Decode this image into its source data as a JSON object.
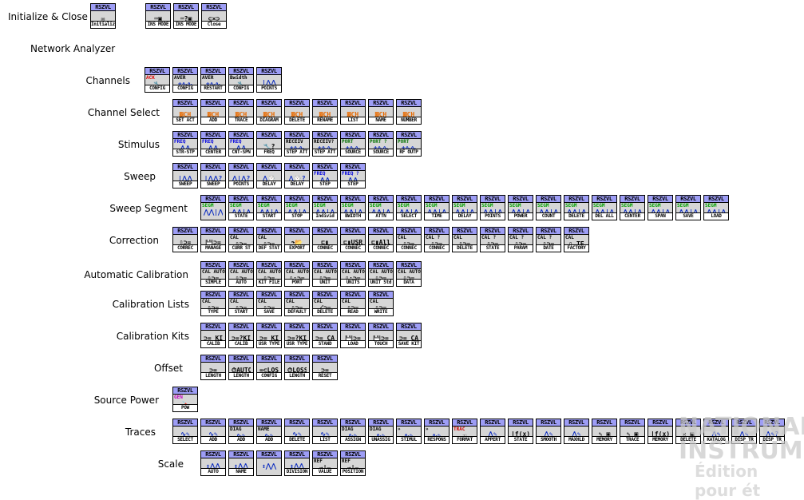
{
  "watermark": {
    "line1": "NATIONAL",
    "line2": "INSTRUMENTS",
    "line3": "Édition pour ét"
  },
  "header_text": "RSZVL",
  "sections": [
    {
      "label": "Initialize & Close",
      "icons": [
        {
          "tag": "",
          "glyph": "✉",
          "tagc": "#c00",
          "foot": "Initialize"
        },
        {
          "gap": true
        },
        {
          "tag": "",
          "glyph": "⌨▣",
          "tagc": "#000",
          "foot": "INS MODE"
        },
        {
          "tag": "",
          "glyph": "⌨?▣",
          "tagc": "#000",
          "foot": "INS MODE"
        },
        {
          "tag": "",
          "glyph": "⊂×⊃",
          "tagc": "#c00",
          "foot": "Close"
        }
      ]
    },
    {
      "label": "Network Analyzer",
      "icons": []
    },
    {
      "label": "Channels",
      "icons": [
        {
          "tag": "ACK",
          "glyph": "🔧",
          "tagc": "#e00000",
          "foot": "CONFIG"
        },
        {
          "tag": "AVER",
          "glyph": "±∿∿",
          "tagc": "#000",
          "foot": "CONFIG"
        },
        {
          "tag": "AVER",
          "glyph": "±∿∿",
          "tagc": "#000",
          "foot": "RESTART"
        },
        {
          "tag": "Bwidth",
          "glyph": "🔧",
          "tagc": "#000",
          "foot": "CONFIG"
        },
        {
          "tag": "",
          "glyph": "|⋀⋀",
          "tagc": "#000",
          "foot": "POINTS"
        }
      ]
    },
    {
      "label": "Channel Select",
      "icons": [
        {
          "tag": "",
          "glyph": "▓CH",
          "tagc": "#000",
          "foot": "SET ACT"
        },
        {
          "tag": "",
          "glyph": "▓CH",
          "tagc": "#000",
          "foot": "ADD"
        },
        {
          "tag": "",
          "glyph": "▓CH",
          "tagc": "#000",
          "foot": "TRACE"
        },
        {
          "tag": "",
          "glyph": "▓CH",
          "tagc": "#000",
          "foot": "DIAGRAM"
        },
        {
          "tag": "",
          "glyph": "▓CH",
          "tagc": "#000",
          "foot": "DELETE"
        },
        {
          "tag": "",
          "glyph": "▓CH",
          "tagc": "#000",
          "foot": "RENAME"
        },
        {
          "tag": "",
          "glyph": "▓CH",
          "tagc": "#000",
          "foot": "LIST"
        },
        {
          "tag": "",
          "glyph": "▓CH",
          "tagc": "#000",
          "foot": "NAME"
        },
        {
          "tag": "",
          "glyph": "▓CH",
          "tagc": "#000",
          "foot": "NUMBER"
        }
      ]
    },
    {
      "label": "Stimulus",
      "icons": [
        {
          "tag": "FREQ",
          "glyph": "⋀⋀",
          "tagc": "#0000e0",
          "foot": "STR-STP"
        },
        {
          "tag": "FREQ",
          "glyph": "⋀⋀",
          "tagc": "#0000e0",
          "foot": "CENTER"
        },
        {
          "tag": "FREQ",
          "glyph": "⋀⋀",
          "tagc": "#0000e0",
          "foot": "CNT-SPN"
        },
        {
          "tag": "",
          "glyph": "🔧?",
          "tagc": "#000",
          "foot": "FREQ"
        },
        {
          "tag": "RECEIV",
          "glyph": "±∿∿",
          "tagc": "#000",
          "foot": "STEP ATT"
        },
        {
          "tag": "RECEIV?",
          "glyph": "±∿∿",
          "tagc": "#000",
          "foot": "STEP ATT"
        },
        {
          "tag": "PORT",
          "glyph": "±∿∿",
          "tagc": "#007000",
          "foot": "SOURCE"
        },
        {
          "tag": "PORT ?",
          "glyph": "±∿∿",
          "tagc": "#007000",
          "foot": "SOURCE"
        },
        {
          "tag": "PORT",
          "glyph": "±∿∿",
          "tagc": "#007000",
          "foot": "RF OUTP"
        }
      ]
    },
    {
      "label": "Sweep",
      "icons": [
        {
          "tag": "",
          "glyph": "|⋀⋀",
          "tagc": "#000",
          "foot": "SWEEP"
        },
        {
          "tag": "",
          "glyph": "|⋀⋀?",
          "tagc": "#000",
          "foot": "SWEEP"
        },
        {
          "tag": "",
          "glyph": "⋀|⋀?",
          "tagc": "#000",
          "foot": "POINTS"
        },
        {
          "tag": "",
          "glyph": "⋀⌚",
          "tagc": "#000",
          "foot": "DELAY"
        },
        {
          "tag": "",
          "glyph": "⋀⌚?",
          "tagc": "#000",
          "foot": "DELAY"
        },
        {
          "tag": "FREQ",
          "glyph": "⋀⋀",
          "tagc": "#0000e0",
          "foot": "STEP"
        },
        {
          "tag": "FREQ ?",
          "glyph": "⋀⋀",
          "tagc": "#0000e0",
          "foot": "STEP"
        }
      ]
    },
    {
      "label": "Sweep Segment",
      "icons": [
        {
          "tag": "SEGM",
          "glyph": "⋀⋀|⋀",
          "tagc": "#00a000",
          "foot": ""
        },
        {
          "tag": "SEGM",
          "glyph": "⋀⋀|⋀",
          "tagc": "#00a000",
          "foot": "STATE"
        },
        {
          "tag": "SEGM",
          "glyph": "⋀⋀|⋀",
          "tagc": "#00a000",
          "foot": "START"
        },
        {
          "tag": "SEGM",
          "glyph": "⋀⋀|⋀",
          "tagc": "#00a000",
          "foot": "STOP"
        },
        {
          "tag": "SEGM",
          "glyph": "⋀⋀|⋀",
          "tagc": "#00a000",
          "foot": "Individ"
        },
        {
          "tag": "SEGM",
          "glyph": "⋀⋀|⋀",
          "tagc": "#00a000",
          "foot": "BWIDTH"
        },
        {
          "tag": "SEGM",
          "glyph": "⋀⋀|⋀",
          "tagc": "#00a000",
          "foot": "ATTN"
        },
        {
          "tag": "SEGM",
          "glyph": "⋀⋀|⋀",
          "tagc": "#00a000",
          "foot": "SELECT"
        },
        {
          "tag": "SEGM",
          "glyph": "⋀⋀|⋀",
          "tagc": "#00a000",
          "foot": "TIME"
        },
        {
          "tag": "SEGM",
          "glyph": "⋀⋀|⋀",
          "tagc": "#00a000",
          "foot": "DELAY"
        },
        {
          "tag": "SEGM",
          "glyph": "⋀⋀|⋀",
          "tagc": "#00a000",
          "foot": "POINTS"
        },
        {
          "tag": "SEGM",
          "glyph": "⋀⋀|⋀",
          "tagc": "#00a000",
          "foot": "POWER"
        },
        {
          "tag": "SEGM",
          "glyph": "⋀⋀|⋀",
          "tagc": "#00a000",
          "foot": "COUNT"
        },
        {
          "tag": "SEGM",
          "glyph": "⋀⋀|⋀",
          "tagc": "#00a000",
          "foot": "DELETE"
        },
        {
          "tag": "SEGM",
          "glyph": "⋀⋀|⋀",
          "tagc": "#00a000",
          "foot": "DEL ALL"
        },
        {
          "tag": "SEGM",
          "glyph": "⋀⋀|⋀",
          "tagc": "#00a000",
          "foot": "CENTER"
        },
        {
          "tag": "SEGM",
          "glyph": "⋀⋀|⋀",
          "tagc": "#00a000",
          "foot": "SPAN"
        },
        {
          "tag": "SEGM",
          "glyph": "⋀⋀|⋀",
          "tagc": "#00a000",
          "foot": "SAVE"
        },
        {
          "tag": "SEGM",
          "glyph": "⋀⋀|⋀",
          "tagc": "#00a000",
          "foot": "LOAD"
        }
      ]
    },
    {
      "label": "Correction",
      "icons": [
        {
          "tag": "",
          "glyph": "▯⊃=",
          "tagc": "#000",
          "foot": "CORREC"
        },
        {
          "tag": "",
          "glyph": "💾⊃=",
          "tagc": "#000",
          "foot": "MANAGE"
        },
        {
          "tag": "CAL",
          "glyph": "▯⊃=",
          "tagc": "#000",
          "foot": "CURR ST"
        },
        {
          "tag": "CAL",
          "glyph": "▯⊃=",
          "tagc": "#000",
          "foot": "DEF STAT"
        },
        {
          "tag": "",
          "glyph": "↷📂",
          "tagc": "#000",
          "foot": "EXPORT"
        },
        {
          "tag": "",
          "glyph": "⊏▮",
          "tagc": "#000",
          "foot": "CONNEC"
        },
        {
          "tag": "",
          "glyph": "⊏▮USR",
          "tagc": "#000",
          "foot": "CONNEC"
        },
        {
          "tag": "",
          "glyph": "⊏▮All",
          "tagc": "#000",
          "foot": "CONNEC"
        },
        {
          "tag": "CAL",
          "glyph": "▯⊃=",
          "tagc": "#000",
          "foot": "CONNEC"
        },
        {
          "tag": "CAL ?",
          "glyph": "▯⊃=",
          "tagc": "#000",
          "foot": "CONNEC"
        },
        {
          "tag": "CAL",
          "glyph": "▯⊃=",
          "tagc": "#000",
          "foot": "DELETE"
        },
        {
          "tag": "CAL ?",
          "glyph": "▯⊃=",
          "tagc": "#000",
          "foot": "STATE"
        },
        {
          "tag": "CAL ?",
          "glyph": "▯⊃=",
          "tagc": "#000",
          "foot": "PARAM"
        },
        {
          "tag": "CAL ?",
          "glyph": "▯⊃=",
          "tagc": "#000",
          "foot": "DATE"
        },
        {
          "tag": "CAL",
          "glyph": "▯ TF",
          "tagc": "#000",
          "foot": "FACTORY"
        }
      ]
    },
    {
      "label": "Automatic Calibration",
      "icons": [
        {
          "tag": "CAL AUTO",
          "glyph": "▯⊃=",
          "tagc": "#000",
          "foot": "SIMPLE"
        },
        {
          "tag": "CAL AUTO",
          "glyph": "▯⊃=",
          "tagc": "#000",
          "foot": "AUTO"
        },
        {
          "tag": "CAL AUTO",
          "glyph": "▯⊃=",
          "tagc": "#000",
          "foot": "KIT FILE"
        },
        {
          "tag": "CAL AUTO",
          "glyph": "▯:⊃=",
          "tagc": "#000",
          "foot": "PORT"
        },
        {
          "tag": "CAL AUTO",
          "glyph": "▯⊃=",
          "tagc": "#000",
          "foot": "UNIT"
        },
        {
          "tag": "CAL AUTO",
          "glyph": "▯:⊃=",
          "tagc": "#000",
          "foot": "UNITS"
        },
        {
          "tag": "CAL AUTO",
          "glyph": "▯⊃=",
          "tagc": "#000",
          "foot": "UNIT Std"
        },
        {
          "tag": "CAL AUTO",
          "glyph": "▯⊃=",
          "tagc": "#000",
          "foot": "DATA"
        }
      ]
    },
    {
      "label": "Calibration Lists",
      "icons": [
        {
          "tag": "CAL",
          "glyph": "▯⊃=",
          "tagc": "#000",
          "foot": "TYPE"
        },
        {
          "tag": "CAL",
          "glyph": "▯⊃=",
          "tagc": "#000",
          "foot": "START"
        },
        {
          "tag": "CAL",
          "glyph": "▯⊃=",
          "tagc": "#000",
          "foot": "SAVE"
        },
        {
          "tag": "CAL",
          "glyph": "▯⊃=",
          "tagc": "#000",
          "foot": "DEFAULT"
        },
        {
          "tag": "CAL",
          "glyph": "⟋⊃=",
          "tagc": "#000",
          "foot": "DELETE"
        },
        {
          "tag": "CAL",
          "glyph": "▯⊃=",
          "tagc": "#000",
          "foot": "READ"
        },
        {
          "tag": "CAL",
          "glyph": "▯⊃=",
          "tagc": "#000",
          "foot": "WRITE"
        }
      ]
    },
    {
      "label": "Calibration Kits",
      "icons": [
        {
          "tag": "",
          "glyph": "⊃= KIT",
          "tagc": "#000",
          "foot": "CALIB"
        },
        {
          "tag": "",
          "glyph": "⊃=?KIT",
          "tagc": "#000",
          "foot": "CALIB"
        },
        {
          "tag": "",
          "glyph": "⊃= KIT",
          "tagc": "#000",
          "foot": "USR TYPE"
        },
        {
          "tag": "",
          "glyph": "⊃=?KIT",
          "tagc": "#000",
          "foot": "USR TYPE"
        },
        {
          "tag": "",
          "glyph": "⊃= CAL",
          "tagc": "#000",
          "foot": "STAND"
        },
        {
          "tag": "",
          "glyph": "💾⊃=",
          "tagc": "#000",
          "foot": "LOAD"
        },
        {
          "tag": "",
          "glyph": "💾⊃=",
          "tagc": "#000",
          "foot": "TOUCH"
        },
        {
          "tag": "",
          "glyph": "⊃= CAL",
          "tagc": "#000",
          "foot": "SAVE KIT"
        }
      ]
    },
    {
      "label": "Offset",
      "icons": [
        {
          "tag": "",
          "glyph": "⊃=",
          "tagc": "#000",
          "foot": "LENGTH"
        },
        {
          "tag": "",
          "glyph": "⏱AUTO",
          "tagc": "#000",
          "foot": "LENGTH"
        },
        {
          "tag": "",
          "glyph": "=⊂LOSS",
          "tagc": "#000",
          "foot": "CONFIG"
        },
        {
          "tag": "",
          "glyph": "⏱LOSS",
          "tagc": "#000",
          "foot": "LENGTH"
        },
        {
          "tag": "",
          "glyph": "⊃=",
          "tagc": "#000",
          "foot": "RESET"
        }
      ]
    },
    {
      "label": "Source Power",
      "icons": [
        {
          "tag": "GEN",
          "glyph": "🪛",
          "tagc": "#c000c0",
          "foot": "POW"
        }
      ]
    },
    {
      "label": "Traces",
      "icons": [
        {
          "tag": "",
          "glyph": "∿✎",
          "tagc": "#000",
          "foot": "SELECT"
        },
        {
          "tag": "",
          "glyph": "∿✎",
          "tagc": "#000",
          "foot": "ADD"
        },
        {
          "tag": "DIAG",
          "glyph": "∿✎",
          "tagc": "#000",
          "foot": "ADD"
        },
        {
          "tag": "NAME",
          "glyph": "∿✎",
          "tagc": "#000",
          "foot": "ADD"
        },
        {
          "tag": "",
          "glyph": "∿✎",
          "tagc": "#000",
          "foot": "DELETE"
        },
        {
          "tag": "",
          "glyph": "∿✎",
          "tagc": "#000",
          "foot": "LIST"
        },
        {
          "tag": "DIAG",
          "glyph": "∿✎",
          "tagc": "#000",
          "foot": "ASSIGN"
        },
        {
          "tag": "DIAG",
          "glyph": "∿✎",
          "tagc": "#000",
          "foot": "UNASSIG"
        },
        {
          "tag": "»",
          "glyph": "∿✎",
          "tagc": "#000",
          "foot": "STIMUL"
        },
        {
          "tag": "»",
          "glyph": "∿✎",
          "tagc": "#000",
          "foot": "RESPONS"
        },
        {
          "tag": "TRAC",
          "glyph": "☜",
          "tagc": "#c00",
          "foot": "FORMAT"
        },
        {
          "tag": "",
          "glyph": "⋀✎",
          "tagc": "#000",
          "foot": "APPERT"
        },
        {
          "tag": "",
          "glyph": "∫f(x)✎",
          "tagc": "#000",
          "foot": "STATE"
        },
        {
          "tag": "",
          "glyph": "⋀✎",
          "tagc": "#000",
          "foot": "SMOOTH"
        },
        {
          "tag": "",
          "glyph": "⋀✎",
          "tagc": "#000",
          "foot": "MAXHLD"
        },
        {
          "tag": "",
          "glyph": "✎ ▣",
          "tagc": "#000",
          "foot": "MEMORY"
        },
        {
          "tag": "",
          "glyph": "✎ ▣",
          "tagc": "#000",
          "foot": "TRACE"
        },
        {
          "tag": "",
          "glyph": "∫f(x)▣",
          "tagc": "#000",
          "foot": "MEMORY"
        },
        {
          "tag": "",
          "glyph": "✕ ▣",
          "tagc": "#000",
          "foot": "DELETE"
        },
        {
          "tag": "",
          "glyph": "⋀✎",
          "tagc": "#000",
          "foot": "KATALOG"
        },
        {
          "tag": "",
          "glyph": "⋀✎",
          "tagc": "#000",
          "foot": "DISP TR"
        },
        {
          "tag": "",
          "glyph": "⋀✎?",
          "tagc": "#000",
          "foot": "DISP TR"
        }
      ]
    },
    {
      "label": "Scale",
      "icons": [
        {
          "tag": "",
          "glyph": "↕⋀⋀",
          "tagc": "#000",
          "foot": "AUTO"
        },
        {
          "tag": "",
          "glyph": "↕⋀⋀",
          "tagc": "#000",
          "foot": "NAME"
        },
        {
          "tag": "",
          "glyph": "↕⋀⋀",
          "tagc": "#000",
          "foot": ""
        },
        {
          "tag": "",
          "glyph": "↕⋀⋀",
          "tagc": "#000",
          "foot": "DIVISION"
        },
        {
          "tag": "REF",
          "glyph": "→|—",
          "tagc": "#000",
          "foot": "VALUE"
        },
        {
          "tag": "REF",
          "glyph": "→|—",
          "tagc": "#000",
          "foot": "POSITION"
        }
      ]
    }
  ]
}
